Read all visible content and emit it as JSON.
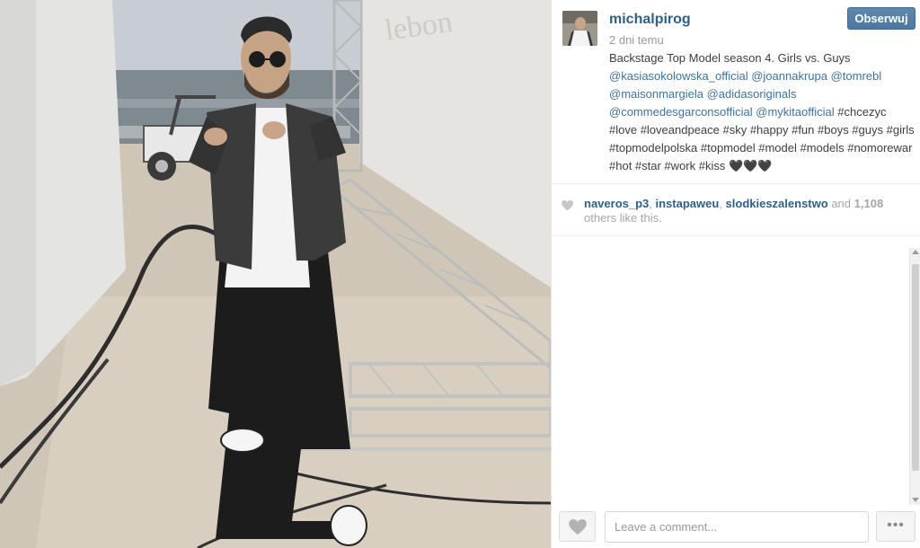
{
  "post": {
    "username": "michalpirog",
    "time_ago": "2 dni temu",
    "follow_label": "Obserwuj",
    "caption": {
      "prefix": "Backstage Top Model season 4. Girls vs. Guys",
      "mentions": [
        "@kasiasokolowska_official",
        "@joannakrupa",
        "@tomrebl",
        "@maisonmargiela",
        "@adidasoriginals",
        "@commedesgarconsofficial",
        "@mykitaofficial"
      ],
      "hashtags_text": "#chcezyc #love #loveandpeace #sky #happy #fun #boys #guys #girls #topmodelpolska #topmodel #model #models #nomorewar #hot #star #work #kiss",
      "emoji": "🖤🖤🖤"
    }
  },
  "likes": {
    "likers": [
      "naveros_p3",
      "instapaweu",
      "slodkieszalenstwo"
    ],
    "and_word": "and",
    "count": "1,108",
    "suffix": "others like this."
  },
  "comment": {
    "placeholder": "Leave a comment...",
    "more_label": "•••"
  },
  "icons": {
    "like_icon": "heart-icon",
    "more_icon": "ellipsis-icon"
  },
  "colors": {
    "link": "#3f729b",
    "username": "#2f5f86",
    "follow_button": "#4f7aa3"
  }
}
